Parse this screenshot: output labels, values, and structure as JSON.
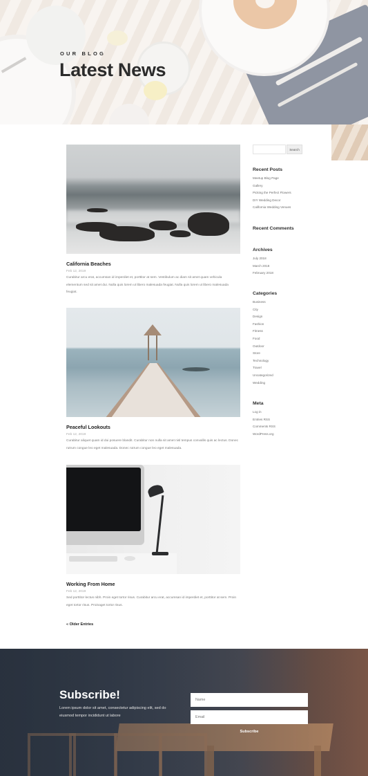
{
  "hero": {
    "eyebrow": "OUR BLOG",
    "title": "Latest News"
  },
  "posts": [
    {
      "title": "California Beaches",
      "date": "Feb 12, 2019",
      "excerpt": "Curabitur arcu erat, accumsan id imperdiet et, porttitor at sem. Vestibulum ac diam sit amet quam vehicula elementum sed sit amet dui. Nulla quis lorem ut libero malesuada feugiat. Nulla quis lorem ut libero malesuada feugiat."
    },
    {
      "title": "Peaceful Lookouts",
      "date": "Feb 12, 2019",
      "excerpt": "Curabitur aliquet quam id dui posuere blandit. Curabitur non nulla sit amet nisl tempus convallis quis ac lectus. Donec rutrum congue leo eget malesuada. Donec rutrum congue leo eget malesuada."
    },
    {
      "title": "Working From Home",
      "date": "Feb 12, 2019",
      "excerpt": "Sed porttitor lectus nibh. Proin eget tortor risus. Curabitur arcu erat, accumsan id imperdiet et, porttitor at sem. Proin eget tortor risus. Proinaget tortor risus."
    }
  ],
  "older_link": "« Older Entries",
  "sidebar": {
    "search_placeholder": "",
    "search_button": "Search",
    "recent_posts": {
      "title": "Recent Posts",
      "items": [
        "Meetup Blog Page",
        "Gallery",
        "Picking the Perfect Flowers",
        "DIY Wedding Decor",
        "California Wedding Venues"
      ]
    },
    "recent_comments": {
      "title": "Recent Comments"
    },
    "archives": {
      "title": "Archives",
      "items": [
        "July 2018",
        "March 2018",
        "February 2018"
      ]
    },
    "categories": {
      "title": "Categories",
      "items": [
        "Business",
        "City",
        "Design",
        "Fashion",
        "Fitness",
        "Food",
        "Outdoor",
        "Store",
        "Technology",
        "Travel",
        "Uncategorized",
        "Wedding"
      ]
    },
    "meta": {
      "title": "Meta",
      "items": [
        "Log in",
        "Entries RSS",
        "Comments RSS",
        "WordPress.org"
      ]
    }
  },
  "subscribe": {
    "title": "Subscribe!",
    "text": "Lorem ipsum dolor sit amet, consectetur adipiscing elit, sed do eiusmod tempor incididunt ut labore",
    "name_placeholder": "Name",
    "email_placeholder": "Email",
    "button": "Subscribe"
  }
}
